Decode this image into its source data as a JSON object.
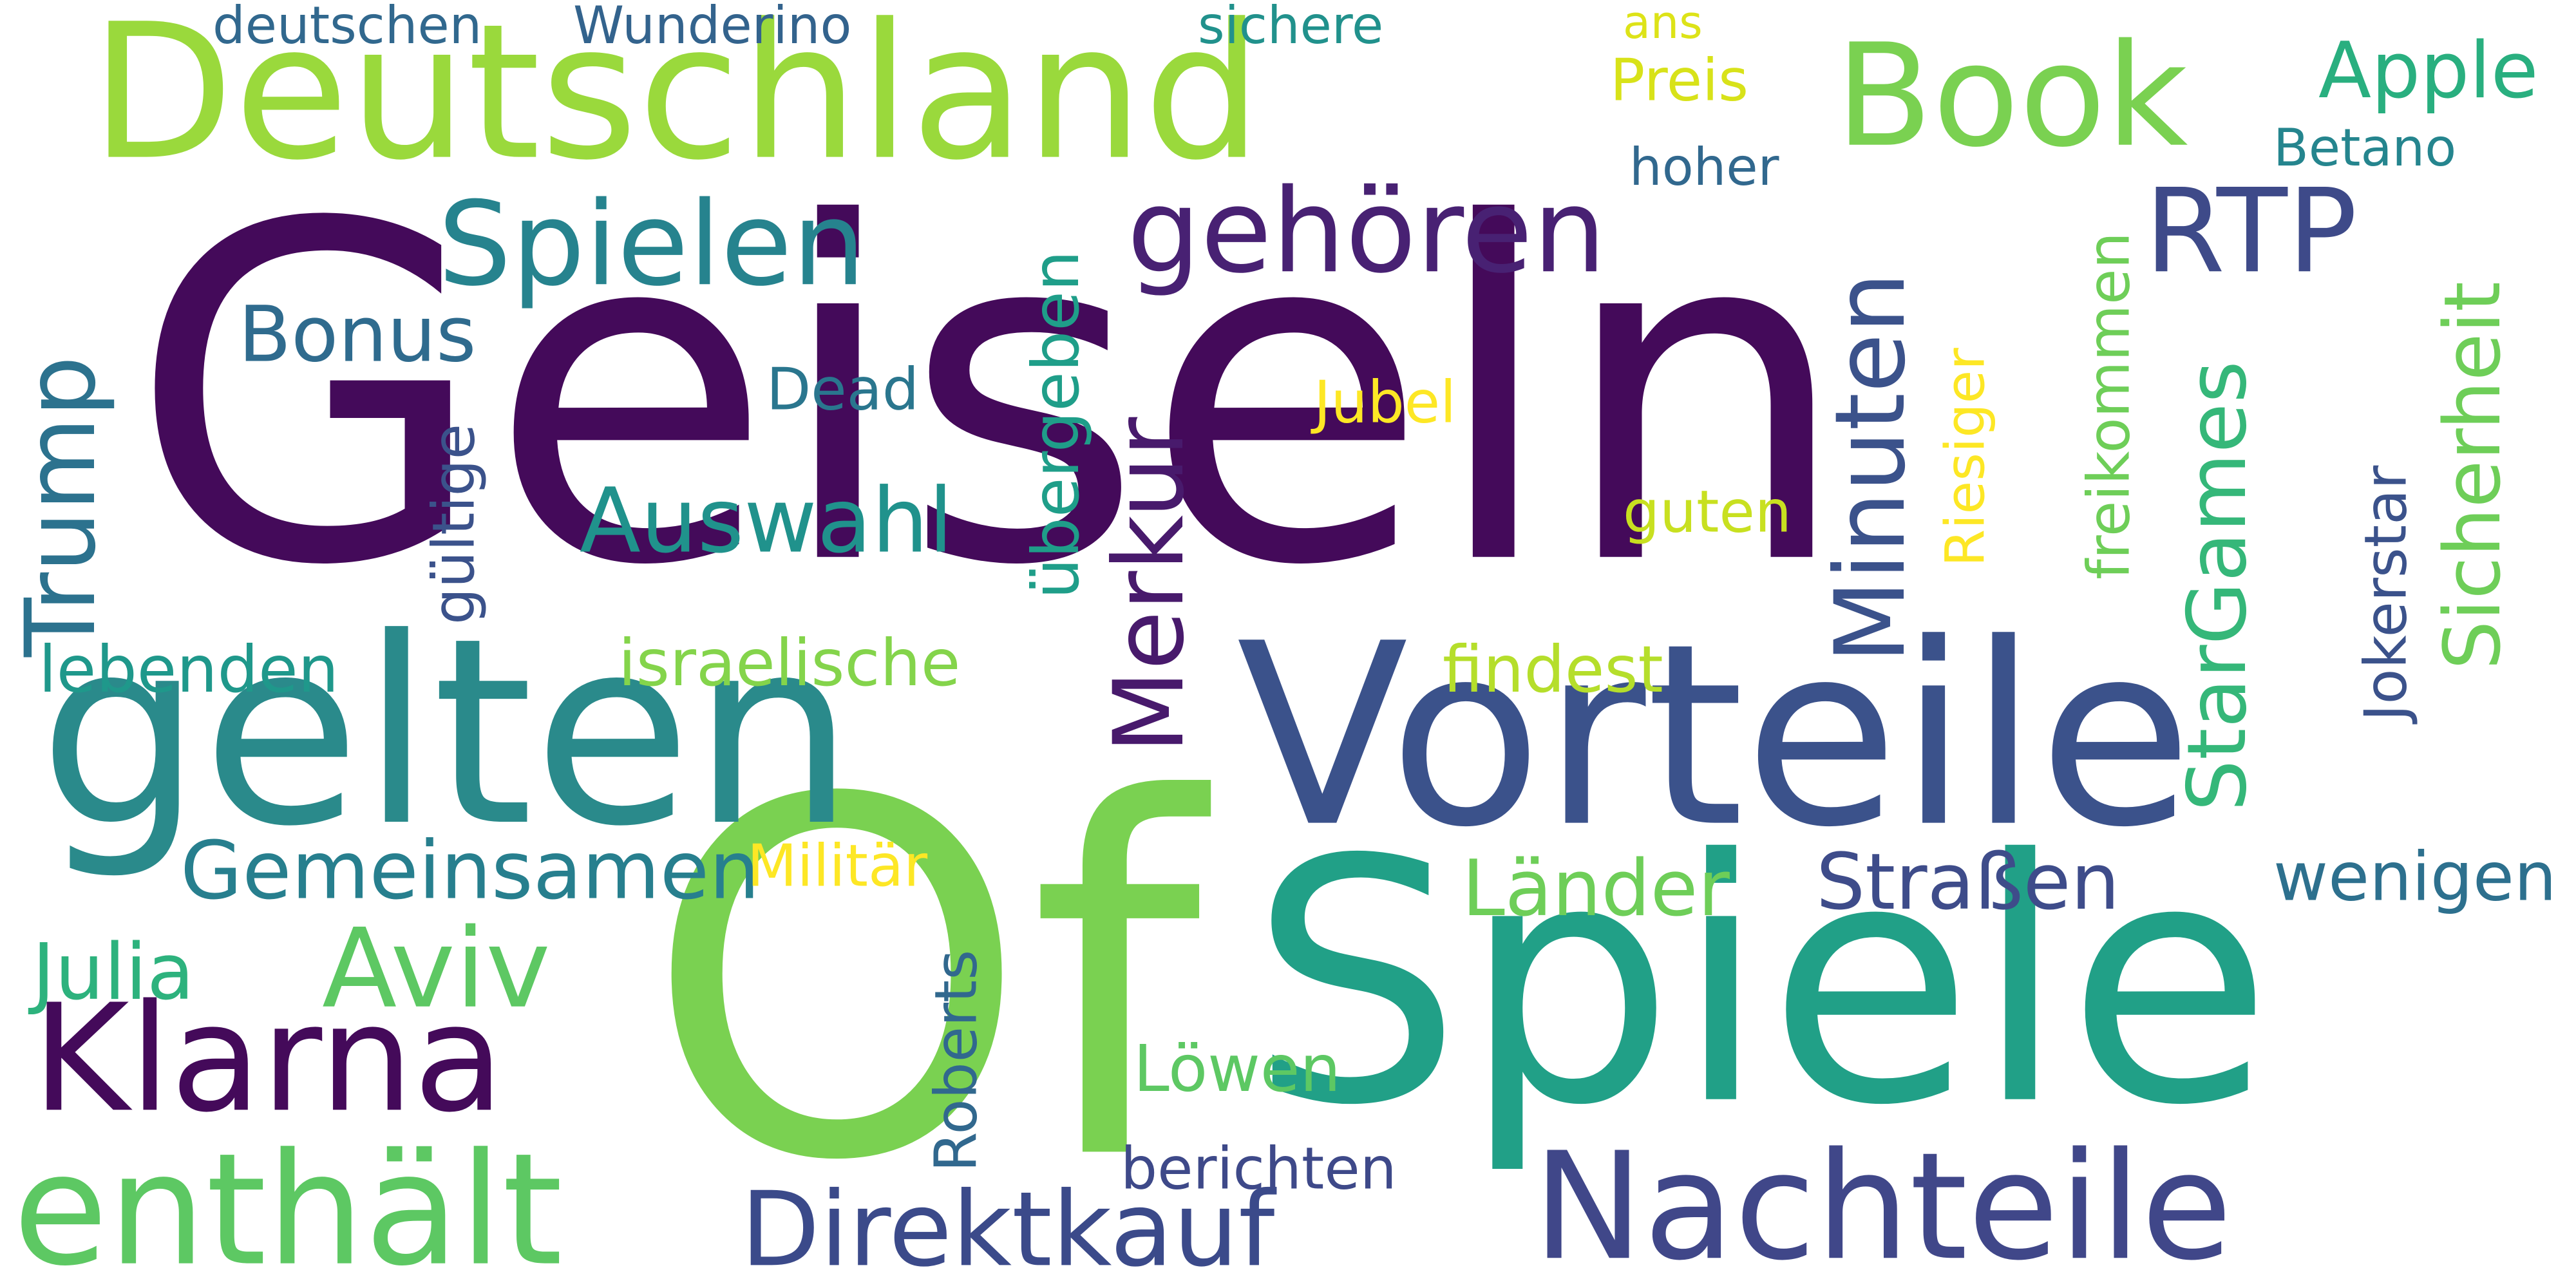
{
  "words": [
    {
      "text": "Geiseln",
      "color": "#440a5a"
    },
    {
      "text": "Of",
      "color": "#7ad151"
    },
    {
      "text": "Spiele",
      "color": "#21a087"
    },
    {
      "text": "Vorteile",
      "color": "#3b528b"
    },
    {
      "text": "gelten",
      "color": "#2a8a8b"
    },
    {
      "text": "Deutschland",
      "color": "#9ad93c"
    },
    {
      "text": "Nachteile",
      "color": "#404789"
    },
    {
      "text": "Book",
      "color": "#7ad151"
    },
    {
      "text": "enthält",
      "color": "#5dc863"
    },
    {
      "text": "Klarna",
      "color": "#440a5a"
    },
    {
      "text": "Direktkauf",
      "color": "#3b4a8a"
    },
    {
      "text": "Merkur",
      "color": "#481a6c"
    },
    {
      "text": "Trump",
      "color": "#2c728e"
    },
    {
      "text": "RTP",
      "color": "#3e4a89"
    },
    {
      "text": "Spielen",
      "color": "#26838e"
    },
    {
      "text": "gehören",
      "color": "#482173"
    },
    {
      "text": "Minuten",
      "color": "#3b528b"
    },
    {
      "text": "Aviv",
      "color": "#5dc863"
    },
    {
      "text": "Auswahl",
      "color": "#20928c"
    },
    {
      "text": "Gemeinsamen",
      "color": "#277f8e"
    },
    {
      "text": "StarGames",
      "color": "#35b779"
    },
    {
      "text": "Sicherheit",
      "color": "#6ece58"
    },
    {
      "text": "Straßen",
      "color": "#3e4c8a"
    },
    {
      "text": "Länder",
      "color": "#6ece58"
    },
    {
      "text": "Bonus",
      "color": "#2f6b8e"
    },
    {
      "text": "Apple",
      "color": "#29af7f"
    },
    {
      "text": "Julia",
      "color": "#2db27d"
    },
    {
      "text": "wenigen",
      "color": "#2d708e"
    },
    {
      "text": "israelische",
      "color": "#84d44b"
    },
    {
      "text": "lebenden",
      "color": "#1f988b"
    },
    {
      "text": "findest",
      "color": "#b5de2b"
    },
    {
      "text": "Riesiger",
      "color": "#fde725"
    },
    {
      "text": "Jokerstar",
      "color": "#3b528b"
    },
    {
      "text": "freikommen",
      "color": "#6ece58"
    },
    {
      "text": "übergeben",
      "color": "#1f9e89"
    },
    {
      "text": "Militär",
      "color": "#fde725"
    },
    {
      "text": "Löwen",
      "color": "#5dc863"
    },
    {
      "text": "berichten",
      "color": "#3e4989"
    },
    {
      "text": "Roberts",
      "color": "#31688e"
    },
    {
      "text": "Jubel",
      "color": "#fde725"
    },
    {
      "text": "guten",
      "color": "#c8e020"
    },
    {
      "text": "Dead",
      "color": "#2a768e"
    },
    {
      "text": "gültige",
      "color": "#3b528b"
    },
    {
      "text": "Preis",
      "color": "#d8e219"
    },
    {
      "text": "Betano",
      "color": "#25858e"
    },
    {
      "text": "hoher",
      "color": "#31688e"
    },
    {
      "text": "ans",
      "color": "#dde318"
    },
    {
      "text": "deutschen",
      "color": "#31688e"
    },
    {
      "text": "Wunderino",
      "color": "#33638d"
    },
    {
      "text": "sichere",
      "color": "#21918c"
    }
  ]
}
